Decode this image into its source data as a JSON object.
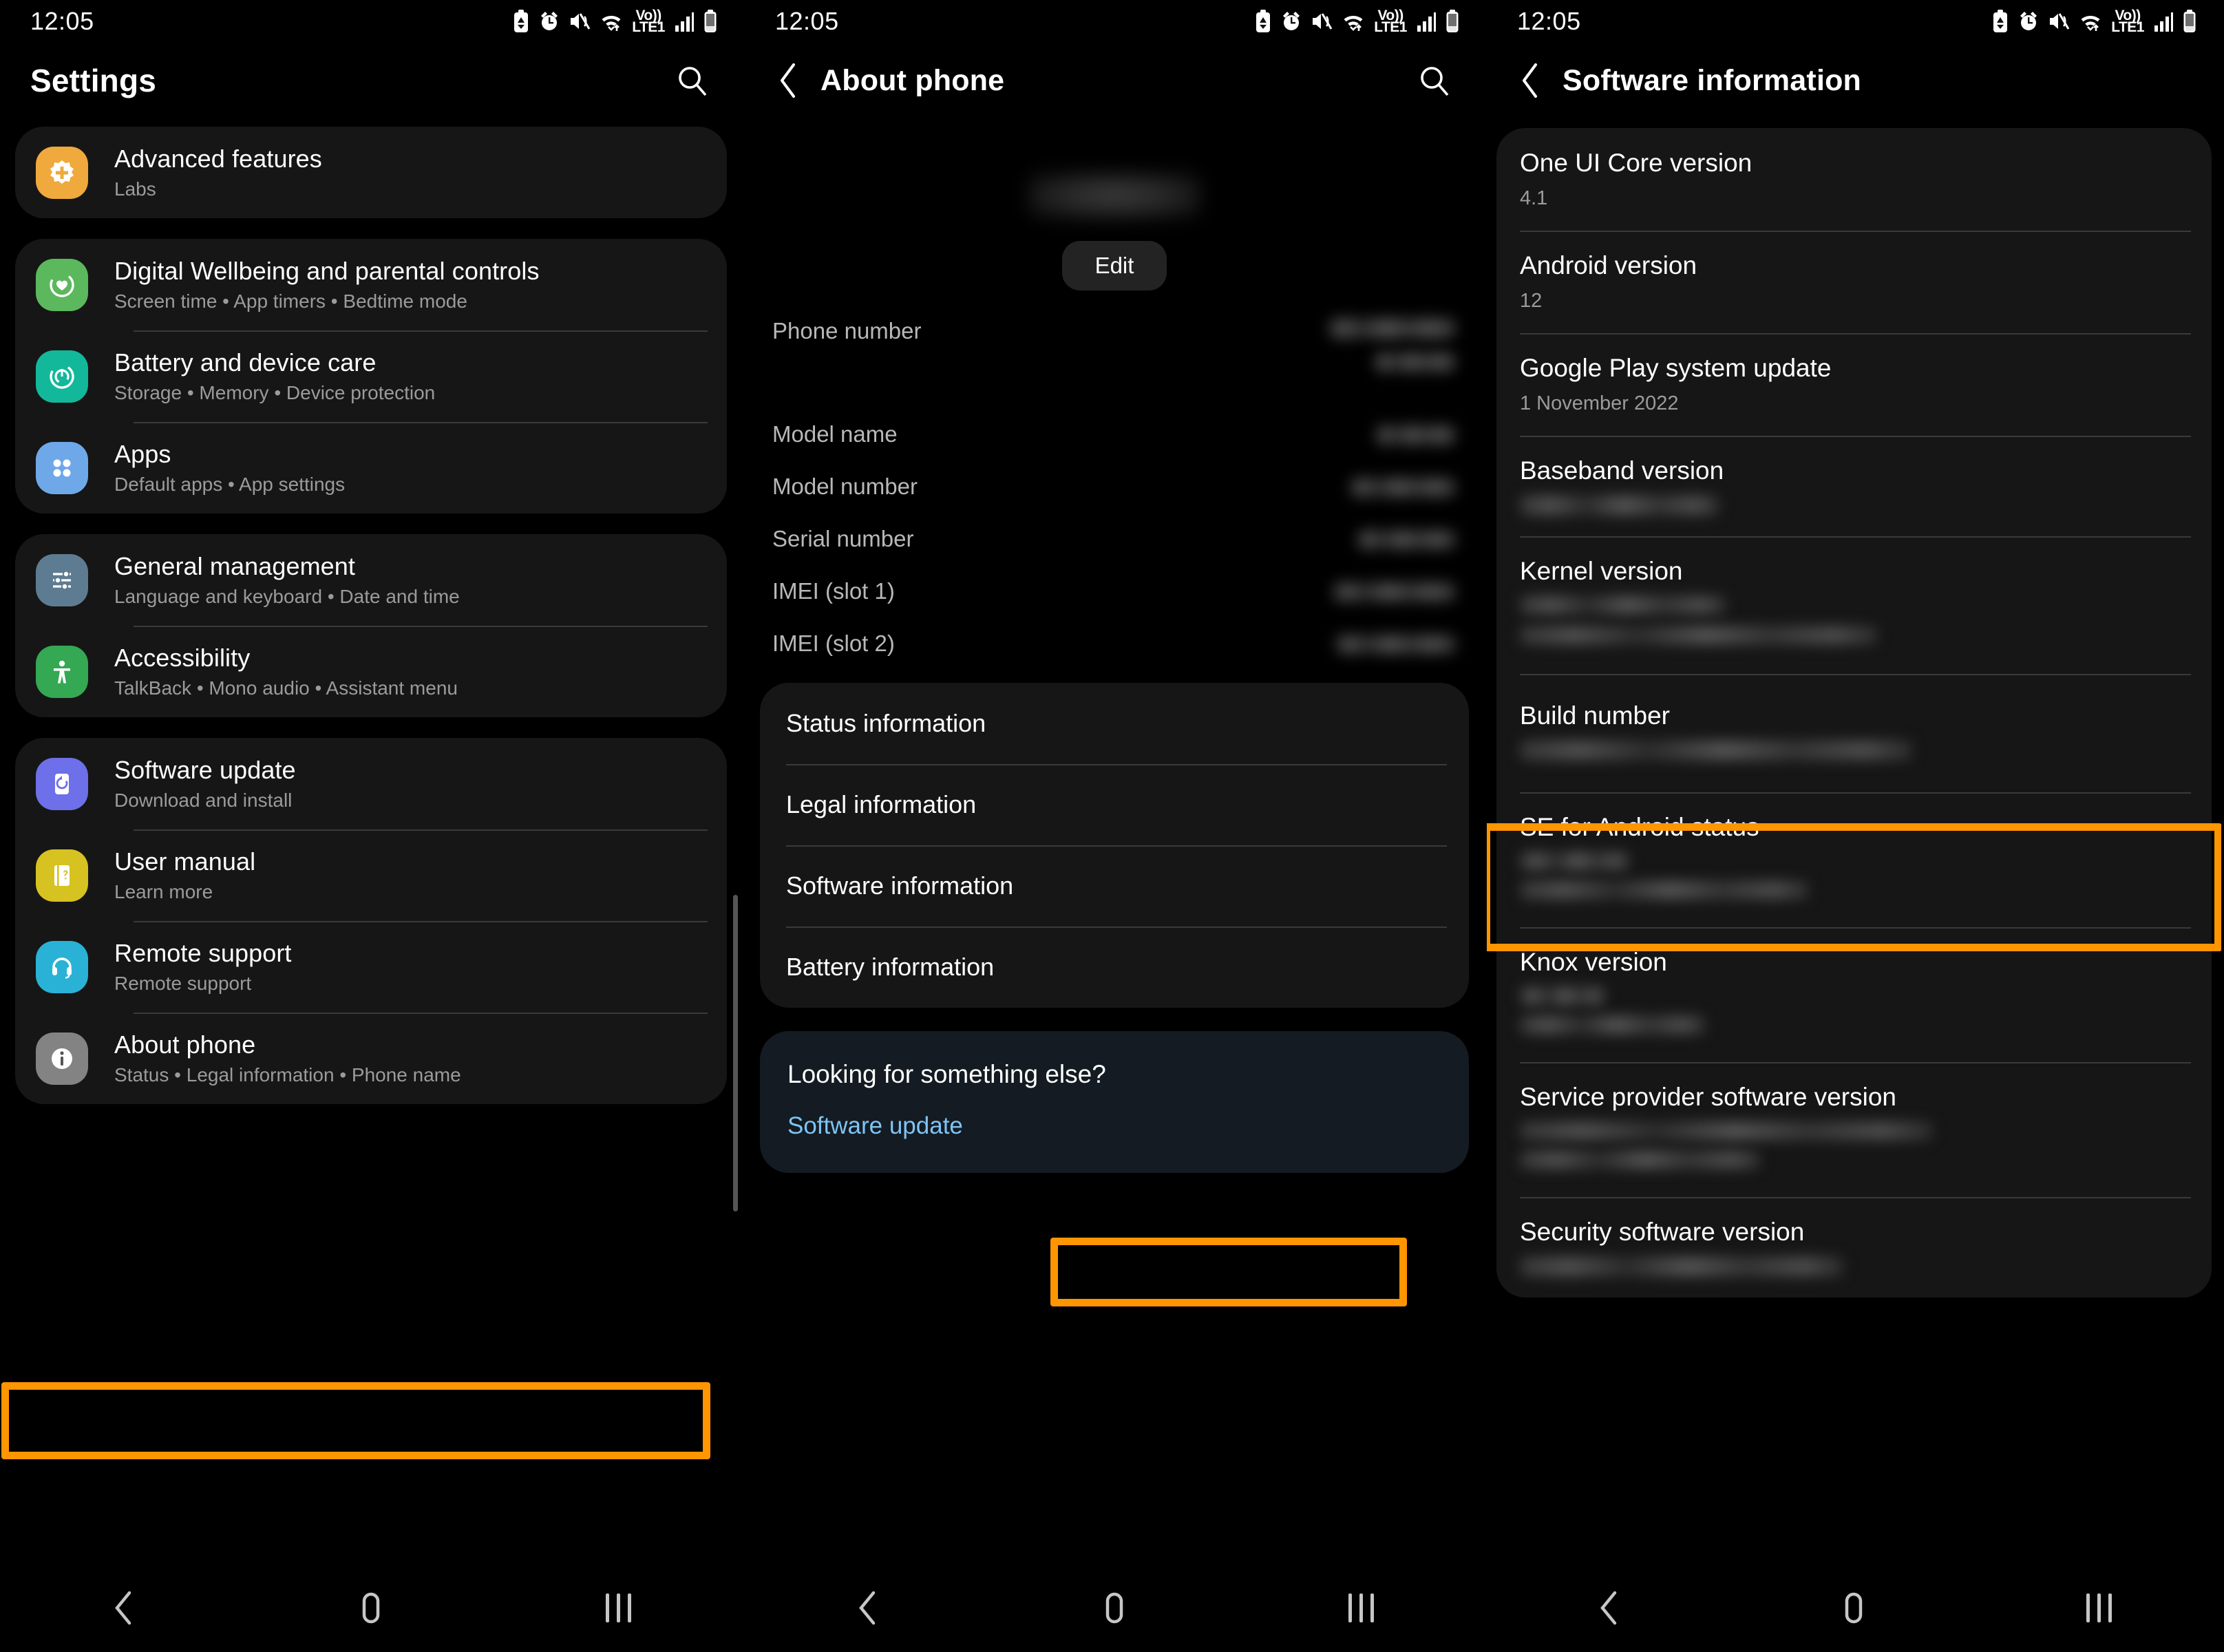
{
  "theme": {
    "accent_highlight": "#ff9500",
    "card_bg": "#161616",
    "page_bg": "#000000",
    "link_blue": "#7fc4f5"
  },
  "status_bar": {
    "time": "12:05",
    "icons": [
      "battery-saver-icon",
      "alarm-icon",
      "mute-vibrate-icon",
      "wifi-icon",
      "volte-lte1-icon",
      "signal-bars-icon",
      "battery-icon"
    ],
    "network_label_top": "Vo))",
    "network_label_bottom": "LTE1"
  },
  "panel1": {
    "title": "Settings",
    "search_icon": "search-icon",
    "groups": [
      {
        "items": [
          {
            "title": "Advanced features",
            "subtitle": "Labs",
            "icon": "advanced-features-icon",
            "color": "#efa93c"
          }
        ]
      },
      {
        "items": [
          {
            "title": "Digital Wellbeing and parental controls",
            "subtitle": "Screen time  •  App timers  •  Bedtime mode",
            "icon": "digital-wellbeing-icon",
            "color": "#5cb85c"
          },
          {
            "title": "Battery and device care",
            "subtitle": "Storage  •  Memory  •  Device protection",
            "icon": "battery-device-care-icon",
            "color": "#13b89a"
          },
          {
            "title": "Apps",
            "subtitle": "Default apps  •  App settings",
            "icon": "apps-icon",
            "color": "#6ea8e8"
          }
        ]
      },
      {
        "items": [
          {
            "title": "General management",
            "subtitle": "Language and keyboard  •  Date and time",
            "icon": "general-management-icon",
            "color": "#5e7c91"
          },
          {
            "title": "Accessibility",
            "subtitle": "TalkBack  •  Mono audio  •  Assistant menu",
            "icon": "accessibility-icon",
            "color": "#34a853"
          }
        ]
      },
      {
        "items": [
          {
            "title": "Software update",
            "subtitle": "Download and install",
            "icon": "software-update-icon",
            "color": "#6d70e8"
          },
          {
            "title": "User manual",
            "subtitle": "Learn more",
            "icon": "user-manual-icon",
            "color": "#d6c221"
          },
          {
            "title": "Remote support",
            "subtitle": "Remote support",
            "icon": "remote-support-icon",
            "color": "#2ab2d6"
          },
          {
            "title": "About phone",
            "subtitle": "Status  •  Legal information  •  Phone name",
            "icon": "about-phone-icon",
            "color": "#838383",
            "highlighted": true
          }
        ]
      }
    ],
    "nav": {
      "back": "back-icon",
      "home": "home-icon",
      "recents": "recents-icon"
    }
  },
  "panel2": {
    "title": "About phone",
    "back_icon": "back-arrow-icon",
    "search_icon": "search-icon",
    "device_name_redacted": true,
    "edit_label": "Edit",
    "info_rows": [
      {
        "label": "Phone number",
        "value_redacted": true,
        "lines": 2
      },
      {
        "label": "Model name",
        "value_redacted": true,
        "lines": 1
      },
      {
        "label": "Model number",
        "value_redacted": true,
        "lines": 1
      },
      {
        "label": "Serial number",
        "value_redacted": true,
        "lines": 1
      },
      {
        "label": "IMEI (slot 1)",
        "value_redacted": true,
        "lines": 1
      },
      {
        "label": "IMEI (slot 2)",
        "value_redacted": true,
        "lines": 1
      }
    ],
    "links": [
      {
        "label": "Status information"
      },
      {
        "label": "Legal information"
      },
      {
        "label": "Software information",
        "highlighted": true
      },
      {
        "label": "Battery information"
      }
    ],
    "looking_else": {
      "title": "Looking for something else?",
      "link": "Software update"
    }
  },
  "panel3": {
    "title": "Software information",
    "back_icon": "back-arrow-icon",
    "rows": [
      {
        "label": "One UI Core version",
        "value": "4.1",
        "redacted": false
      },
      {
        "label": "Android version",
        "value": "12",
        "redacted": false
      },
      {
        "label": "Google Play system update",
        "value": "1 November 2022",
        "redacted": false
      },
      {
        "label": "Baseband version",
        "value": "",
        "redacted": true,
        "lines": 1
      },
      {
        "label": "Kernel version",
        "value": "",
        "redacted": true,
        "lines": 2
      },
      {
        "label": "Build number",
        "value": "",
        "redacted": true,
        "lines": 1,
        "highlighted": true
      },
      {
        "label": "SE for Android status",
        "value": "",
        "redacted": true,
        "lines": 2
      },
      {
        "label": "Knox version",
        "value": "",
        "redacted": true,
        "lines": 2
      },
      {
        "label": "Service provider software version",
        "value": "",
        "redacted": true,
        "lines": 2
      },
      {
        "label": "Security software version",
        "value": "",
        "redacted": true,
        "lines": 1
      }
    ]
  }
}
